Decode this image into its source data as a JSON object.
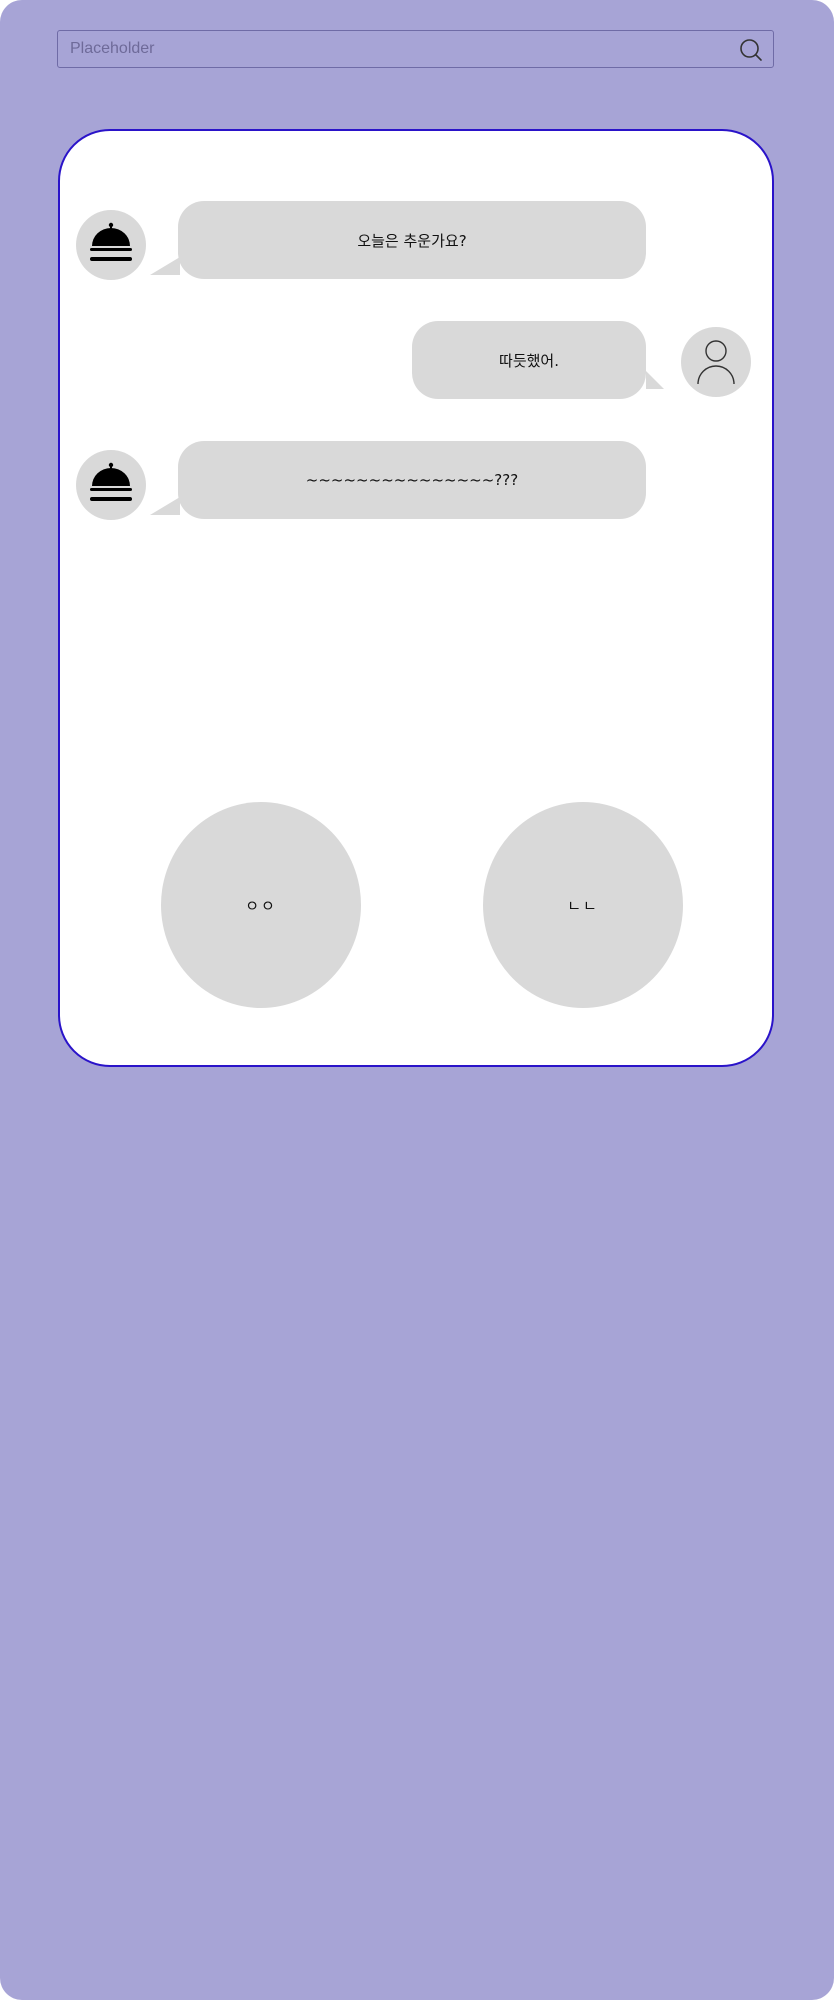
{
  "search": {
    "placeholder": "Placeholder",
    "icon": "search-icon"
  },
  "chat": {
    "messages": [
      {
        "sender": "bot",
        "avatar_icon": "cloche-icon",
        "text": "오늘은 추운가요?"
      },
      {
        "sender": "user",
        "avatar_icon": "user-icon",
        "text": "따듯했어."
      },
      {
        "sender": "bot",
        "avatar_icon": "cloche-icon",
        "text": "~~~~~~~~~~~~~~~???"
      }
    ],
    "replies": [
      {
        "label": "ㅇㅇ"
      },
      {
        "label": "ㄴㄴ"
      }
    ]
  },
  "colors": {
    "background": "#a7a4d6",
    "card_border": "#2a13c9",
    "bubble": "#d9d9d9",
    "card": "#ffffff"
  }
}
